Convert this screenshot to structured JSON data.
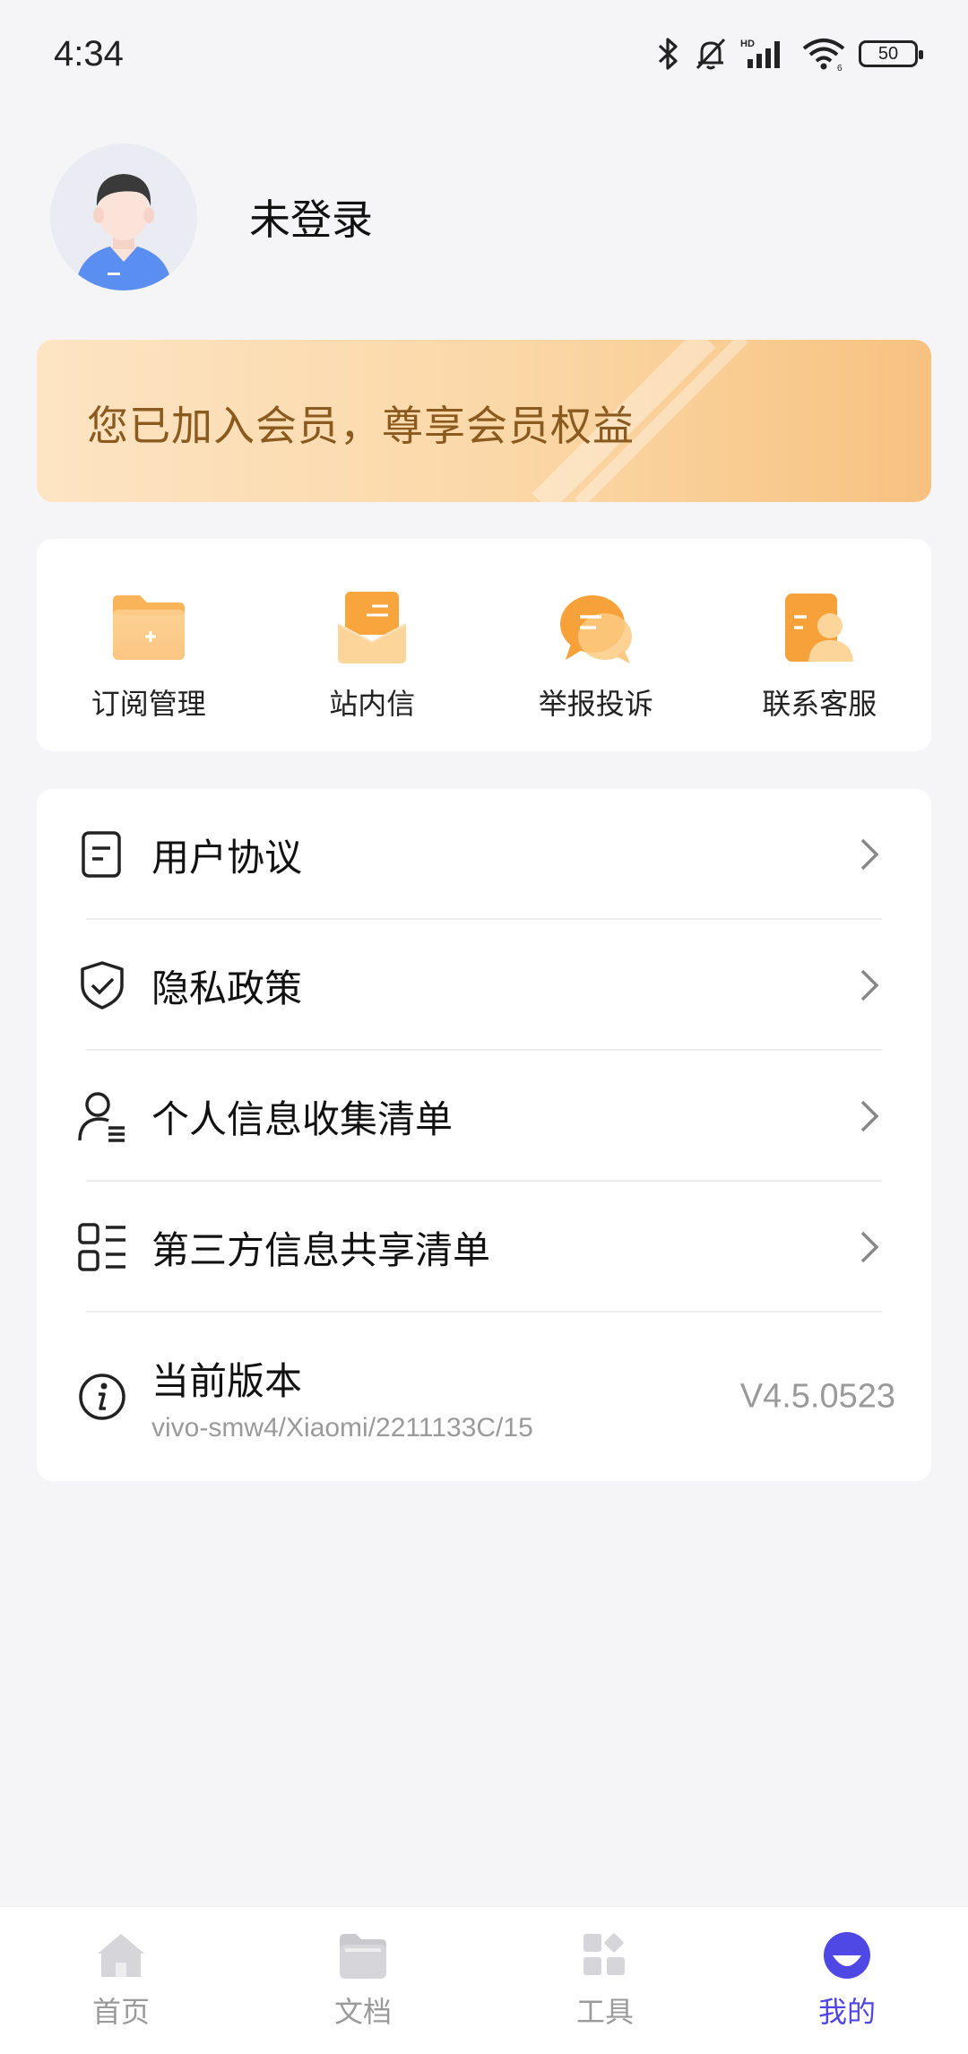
{
  "status_bar": {
    "time": "4:34",
    "battery": "50",
    "icons": [
      "bluetooth-icon",
      "mute-bell-icon",
      "hd-signal-icon",
      "wifi-icon",
      "battery-icon"
    ]
  },
  "profile": {
    "name": "未登录",
    "avatar_icon": "user-avatar-icon"
  },
  "member_banner": {
    "text": "您已加入会员，尊享会员权益"
  },
  "quick_actions": [
    {
      "label": "订阅管理",
      "icon": "folder-plus-icon"
    },
    {
      "label": "站内信",
      "icon": "envelope-icon"
    },
    {
      "label": "举报投诉",
      "icon": "chat-bubble-icon"
    },
    {
      "label": "联系客服",
      "icon": "customer-service-icon"
    }
  ],
  "settings": {
    "items": [
      {
        "label": "用户协议",
        "icon": "document-icon"
      },
      {
        "label": "隐私政策",
        "icon": "shield-check-icon"
      },
      {
        "label": "个人信息收集清单",
        "icon": "user-list-icon"
      },
      {
        "label": "第三方信息共享清单",
        "icon": "grid-list-icon"
      }
    ],
    "version": {
      "label": "当前版本",
      "sub": "vivo-smw4/Xiaomi/2211133C/15",
      "value": "V4.5.0523",
      "icon": "info-icon"
    }
  },
  "bottom_nav": {
    "items": [
      {
        "label": "首页",
        "icon": "home-icon",
        "active": false
      },
      {
        "label": "文档",
        "icon": "folder-icon",
        "active": false
      },
      {
        "label": "工具",
        "icon": "tools-grid-icon",
        "active": false
      },
      {
        "label": "我的",
        "icon": "profile-icon",
        "active": true
      }
    ]
  },
  "colors": {
    "accent": "#4f46e5",
    "member_text": "#8a5a1e",
    "icon_orange": "#f7b450",
    "background": "#f5f5f7"
  }
}
